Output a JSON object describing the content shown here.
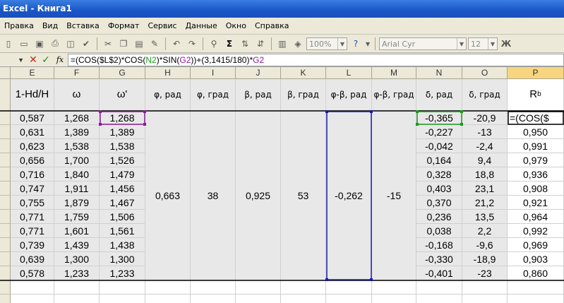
{
  "window": {
    "title": "Excel - Книга1"
  },
  "menu": [
    "Правка",
    "Вид",
    "Вставка",
    "Формат",
    "Сервис",
    "Данные",
    "Окно",
    "Справка"
  ],
  "toolbar": {
    "zoom": "100%",
    "font": "Arial Cyr",
    "font_size": "12"
  },
  "formula": {
    "cancel": "✕",
    "enter": "✓",
    "fx": "fx",
    "parts": [
      {
        "t": "=(COS($L$2)*COS(",
        "c": "#000000"
      },
      {
        "t": "N2",
        "c": "#1a9a1a"
      },
      {
        "t": ")*SIN(",
        "c": "#000000"
      },
      {
        "t": "G2",
        "c": "#8a1a9a"
      },
      {
        "t": "))+(3,1415/180)*",
        "c": "#000000"
      },
      {
        "t": "G2",
        "c": "#8a1a9a"
      }
    ]
  },
  "columns": [
    "E",
    "F",
    "G",
    "H",
    "I",
    "J",
    "K",
    "L",
    "M",
    "N",
    "O",
    "P"
  ],
  "headers": {
    "E": "1-Hd/H",
    "F": "ω",
    "G": "ω'",
    "H": "φ, рад",
    "I": "φ, град",
    "J": "β, рад",
    "K": "β, град",
    "L": "φ-β, рад",
    "M": "φ-β, град",
    "N": "δ, рад",
    "O": "δ, град",
    "P_main": "R",
    "P_sub": "b"
  },
  "merged": {
    "H": "0,663",
    "I": "38",
    "J": "0,925",
    "K": "53",
    "L": "-0,262",
    "M": "-15"
  },
  "rows": [
    {
      "E": "0,587",
      "F": "1,268",
      "G": "1,268",
      "N": "-0,365",
      "O": "-20,9",
      "P": "=(COS($"
    },
    {
      "E": "0,631",
      "F": "1,389",
      "G": "1,389",
      "N": "-0,227",
      "O": "-13",
      "P": "0,950"
    },
    {
      "E": "0,623",
      "F": "1,538",
      "G": "1,538",
      "N": "-0,042",
      "O": "-2,4",
      "P": "0,991"
    },
    {
      "E": "0,656",
      "F": "1,700",
      "G": "1,526",
      "N": "0,164",
      "O": "9,4",
      "P": "0,979"
    },
    {
      "E": "0,716",
      "F": "1,840",
      "G": "1,479",
      "N": "0,328",
      "O": "18,8",
      "P": "0,936"
    },
    {
      "E": "0,747",
      "F": "1,911",
      "G": "1,456",
      "N": "0,403",
      "O": "23,1",
      "P": "0,908"
    },
    {
      "E": "0,755",
      "F": "1,879",
      "G": "1,467",
      "N": "0,370",
      "O": "21,2",
      "P": "0,921"
    },
    {
      "E": "0,771",
      "F": "1,759",
      "G": "1,506",
      "N": "0,236",
      "O": "13,5",
      "P": "0,964"
    },
    {
      "E": "0,771",
      "F": "1,601",
      "G": "1,561",
      "N": "0,038",
      "O": "2,2",
      "P": "0,992"
    },
    {
      "E": "0,739",
      "F": "1,439",
      "G": "1,438",
      "N": "-0,168",
      "O": "-9,6",
      "P": "0,969"
    },
    {
      "E": "0,639",
      "F": "1,300",
      "G": "1,300",
      "N": "-0,330",
      "O": "-18,9",
      "P": "0,903"
    },
    {
      "E": "0,578",
      "F": "1,233",
      "G": "1,233",
      "N": "-0,401",
      "O": "-23",
      "P": "0,860"
    }
  ],
  "colors": {
    "ref_green": "#1a9a1a",
    "ref_purple": "#8a1a9a",
    "ref_blue": "#1a1aa8"
  }
}
